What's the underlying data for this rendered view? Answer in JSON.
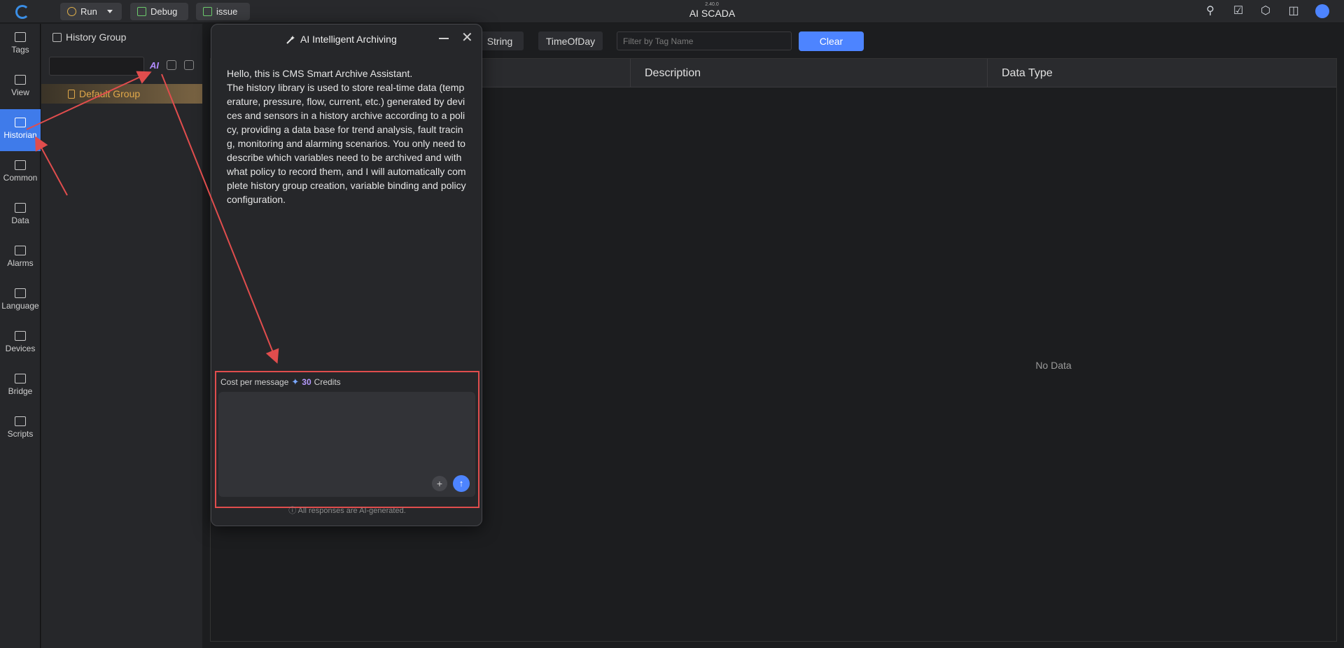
{
  "topbar": {
    "run_label": "Run",
    "debug_label": "Debug",
    "issue_label": "issue",
    "version": "2.40.0",
    "title": "AI SCADA"
  },
  "sidebar": {
    "items": [
      {
        "label": "Tags"
      },
      {
        "label": "View"
      },
      {
        "label": "Historian"
      },
      {
        "label": "Common"
      },
      {
        "label": "Data"
      },
      {
        "label": "Alarms"
      },
      {
        "label": "Language"
      },
      {
        "label": "Devices"
      },
      {
        "label": "Bridge"
      },
      {
        "label": "Scripts"
      }
    ],
    "active": "Historian"
  },
  "group_panel": {
    "title": "History Group",
    "search_value": "",
    "ai_label": "AI",
    "groups": [
      {
        "label": "Default Group"
      }
    ]
  },
  "filters": {
    "types": [
      "String",
      "TimeOfDay"
    ],
    "tag_filter_placeholder": "Filter by Tag Name",
    "clear_label": "Clear"
  },
  "table": {
    "columns": [
      "",
      "Description",
      "Data Type"
    ],
    "empty_text": "No Data"
  },
  "dialog": {
    "title": "AI Intelligent Archiving",
    "greeting_title": "Hello, this is CMS Smart Archive Assistant.",
    "greeting_body": "The history library is used to store real-time data (temperature, pressure, flow, current, etc.) generated by devices and sensors in a history archive according to a policy, providing a data base for trend analysis, fault tracing, monitoring and alarming scenarios. You only need to describe which variables need to be archived and with what policy to record them, and I will automatically complete history group creation, variable binding and policy configuration.",
    "cost_label": "Cost per message",
    "cost_value": "30",
    "cost_unit": "Credits",
    "message_value": "",
    "disclaimer": "All responses are AI-generated."
  },
  "colors": {
    "accent": "#4d84ff",
    "annotation": "#e04d4d",
    "group_highlight": "#e0a84a"
  }
}
